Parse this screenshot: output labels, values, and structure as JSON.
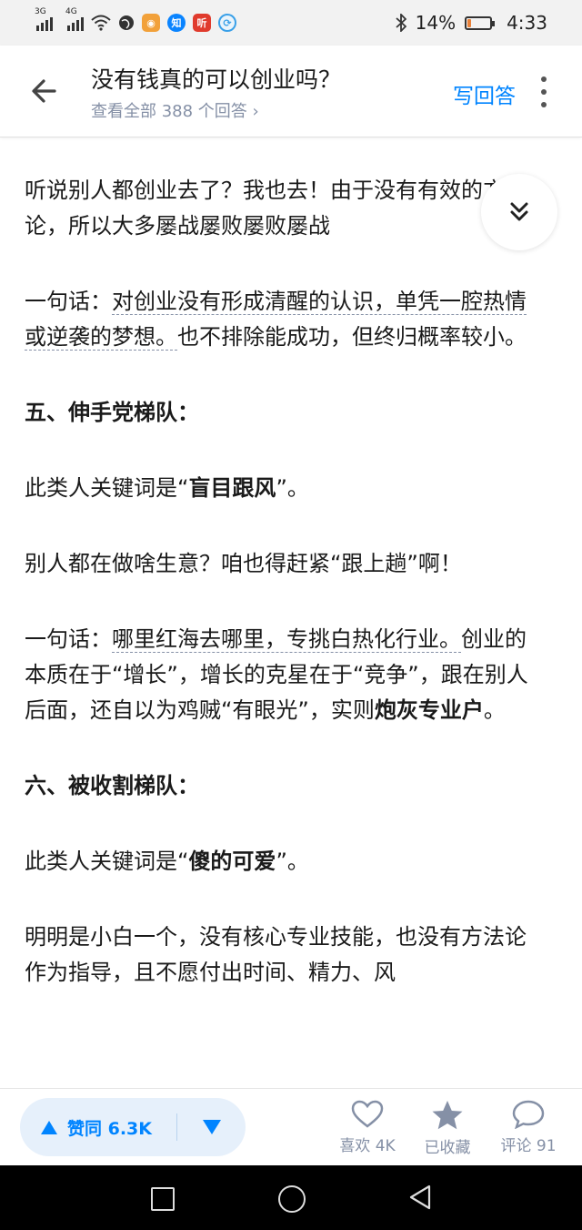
{
  "status_bar": {
    "net1": "3G",
    "net2": "4G",
    "app_icon_2": "知",
    "app_icon_3": "听",
    "battery_text": "14%",
    "battery_level": 0.14,
    "time": "4:33"
  },
  "header": {
    "title": "没有钱真的可以创业吗？",
    "subtitle": "查看全部 388 个回答 ›",
    "write_answer": "写回答"
  },
  "content": {
    "p1": "听说别人都创业去了？我也去！由于没有有效的方法论，所以大多屡战屡败屡败屡战",
    "p2_prefix": "一句话：",
    "p2_underlined": "对创业没有形成清醒的认识，单凭一腔热情或逆袭的梦想。",
    "p2_rest": "也不排除能成功，但终归概率较小。",
    "h5": "五、伸手党梯队：",
    "p3_prefix": "此类人关键词是“",
    "p3_bold": "盲目跟风",
    "p3_suffix": "”。",
    "p4": "别人都在做啥生意？咱也得赶紧“跟上趟”啊！",
    "p5_prefix": "一句话：",
    "p5_underlined": "哪里红海去哪里，专挑白热化行业。",
    "p5_rest": "创业的本质在于“增长”，增长的克星在于“竞争”，跟在别人后面，还自以为鸡贼“有眼光”，实则",
    "p5_bold": "炮灰专业户",
    "p5_end": "。",
    "h6": "六、被收割梯队：",
    "p6_prefix": "此类人关键词是“",
    "p6_bold": "傻的可爱",
    "p6_suffix": "”。",
    "p7": "明明是小白一个，没有核心专业技能，也没有方法论作为指导，且不愿付出时间、精力、风"
  },
  "bottom_bar": {
    "upvote_label": "赞同 6.3K",
    "like_label": "喜欢 4K",
    "collect_label": "已收藏",
    "comment_label": "评论 91"
  },
  "colors": {
    "accent": "#0084ff",
    "muted": "#8590a6",
    "vote_bg": "#e6f0fb"
  },
  "icons": [
    "back-arrow-icon",
    "more-vertical-icon",
    "collapse-chevron-icon",
    "upvote-triangle-icon",
    "downvote-triangle-icon",
    "heart-icon",
    "star-icon",
    "comment-bubble-icon",
    "nav-square-icon",
    "nav-circle-icon",
    "nav-back-icon"
  ]
}
